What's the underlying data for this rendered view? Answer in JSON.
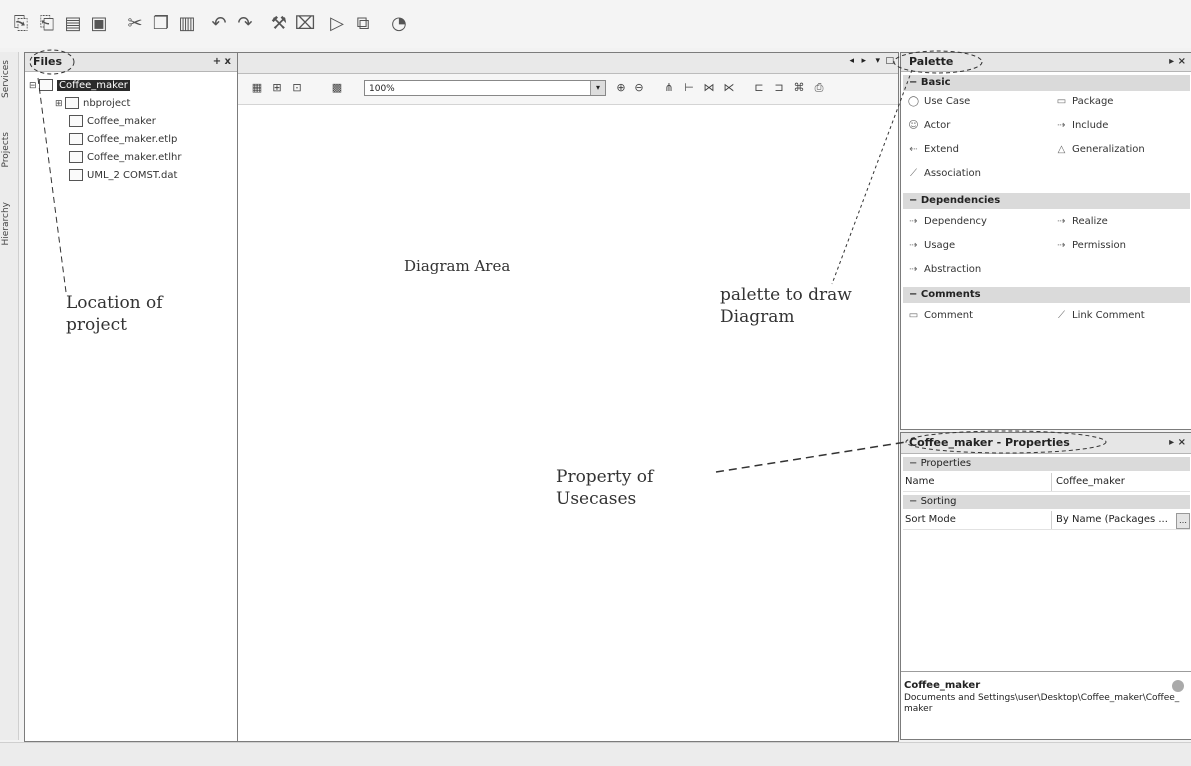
{
  "toolbar": {
    "icons": [
      "new-file-icon",
      "new-project-icon",
      "open-project-icon",
      "save-all-icon",
      "cut-icon",
      "copy-icon",
      "paste-icon",
      "undo-icon",
      "redo-icon",
      "build-icon",
      "clean-build-icon",
      "run-icon",
      "debug-icon",
      "profile-icon"
    ]
  },
  "left_strip": {
    "tabs": [
      "Services",
      "Projects",
      "Hierarchy"
    ]
  },
  "files_panel": {
    "title": "Files",
    "controls": "+ x",
    "tree": [
      {
        "label": "Coffee_maker",
        "expander": "⊟"
      },
      {
        "label": "nbproject",
        "expander": "⊞"
      },
      {
        "label": "Coffee_maker",
        "expander": ""
      },
      {
        "label": "Coffee_maker.etlp",
        "expander": ""
      },
      {
        "label": "Coffee_maker.etlhr",
        "expander": ""
      },
      {
        "label": "UML_2 COMST.dat",
        "expander": ""
      }
    ]
  },
  "editor": {
    "zoom_value": "100%",
    "diagram_label": "Diagram Area"
  },
  "palette": {
    "title": "Palette",
    "categories": [
      {
        "name": "Basic",
        "items": [
          "Use Case",
          "Package",
          "Actor",
          "Include",
          "Extend",
          "Generalization",
          "Association"
        ]
      },
      {
        "name": "Dependencies",
        "items": [
          "Dependency",
          "Realize",
          "Usage",
          "Permission",
          "Abstraction"
        ]
      },
      {
        "name": "Comments",
        "items": [
          "Comment",
          "Link Comment"
        ]
      }
    ]
  },
  "properties": {
    "title": "Coffee_maker - Properties",
    "sections": [
      {
        "name": "Properties",
        "rows": [
          {
            "key": "Name",
            "value": "Coffee_maker"
          }
        ]
      },
      {
        "name": "Sorting",
        "rows": [
          {
            "key": "Sort Mode",
            "value": "By Name (Packages ..."
          }
        ]
      }
    ],
    "footer_name": "Coffee_maker",
    "footer_desc": "Documents and Settings\\user\\Desktop\\Coffee_maker\\Coffee_maker"
  },
  "annotations": {
    "location_line1": "Location of",
    "location_line2": "project",
    "palette_line1": "palette to draw",
    "palette_line2": "Diagram",
    "property_line1": "Property of",
    "property_line2": "Usecases"
  }
}
